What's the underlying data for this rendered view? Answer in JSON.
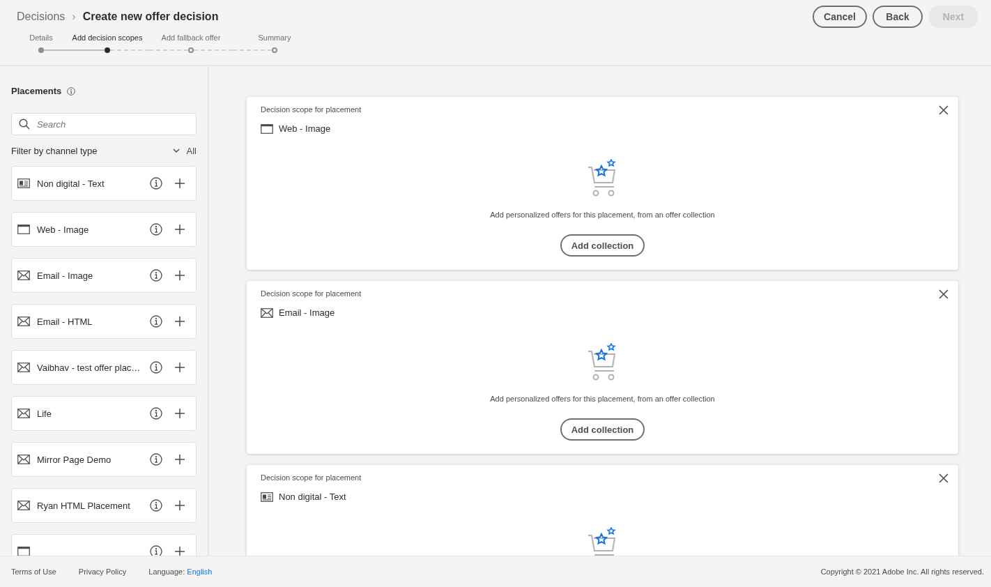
{
  "breadcrumb": {
    "parent": "Decisions",
    "separator": "›",
    "title": "Create new offer decision"
  },
  "buttons": [
    {
      "label": "Cancel",
      "disabled": false
    },
    {
      "label": "Back",
      "disabled": false
    },
    {
      "label": "Next",
      "disabled": true
    }
  ],
  "steps": [
    {
      "label": "Details",
      "completed": true,
      "selected": false
    },
    {
      "label": "Add decision scopes",
      "completed": false,
      "selected": true
    },
    {
      "label": "Add fallback offer",
      "completed": false,
      "selected": false
    },
    {
      "label": "Summary",
      "completed": false,
      "selected": false
    }
  ],
  "sidebar": {
    "title": "Placements",
    "search": {
      "placeholder": "Search"
    },
    "filter": {
      "label": "Filter by channel type",
      "value": "All"
    },
    "items": [
      {
        "label": "Non digital - Text",
        "kind": "text"
      },
      {
        "label": "Web - Image",
        "kind": "web"
      },
      {
        "label": "Email - Image",
        "kind": "email"
      },
      {
        "label": "Email - HTML",
        "kind": "email"
      },
      {
        "label": "Vaibhav - test offer plac…",
        "kind": "email"
      },
      {
        "label": "Life",
        "kind": "email"
      },
      {
        "label": "Mirror Page Demo",
        "kind": "email"
      },
      {
        "label": "Ryan HTML Placement",
        "kind": "email"
      },
      {
        "kind": "web"
      }
    ]
  },
  "scopes": [
    {
      "caption": "Decision scope for placement",
      "label": "Web - Image",
      "kind": "web",
      "description": "Add personalized offers for this placement, from an offer collection",
      "button": "Add collection"
    },
    {
      "caption": "Decision scope for placement",
      "label": "Email - Image",
      "kind": "email",
      "description": "Add personalized offers for this placement, from an offer collection",
      "button": "Add collection"
    },
    {
      "caption": "Decision scope for placement",
      "label": "Non digital - Text",
      "kind": "text"
    }
  ],
  "footer": {
    "links": [
      "Terms of Use",
      "Privacy Policy"
    ],
    "language_label": "Language:",
    "language": "English",
    "copyright": "Copyright ©  2021 Adobe Inc.  All rights reserved."
  }
}
